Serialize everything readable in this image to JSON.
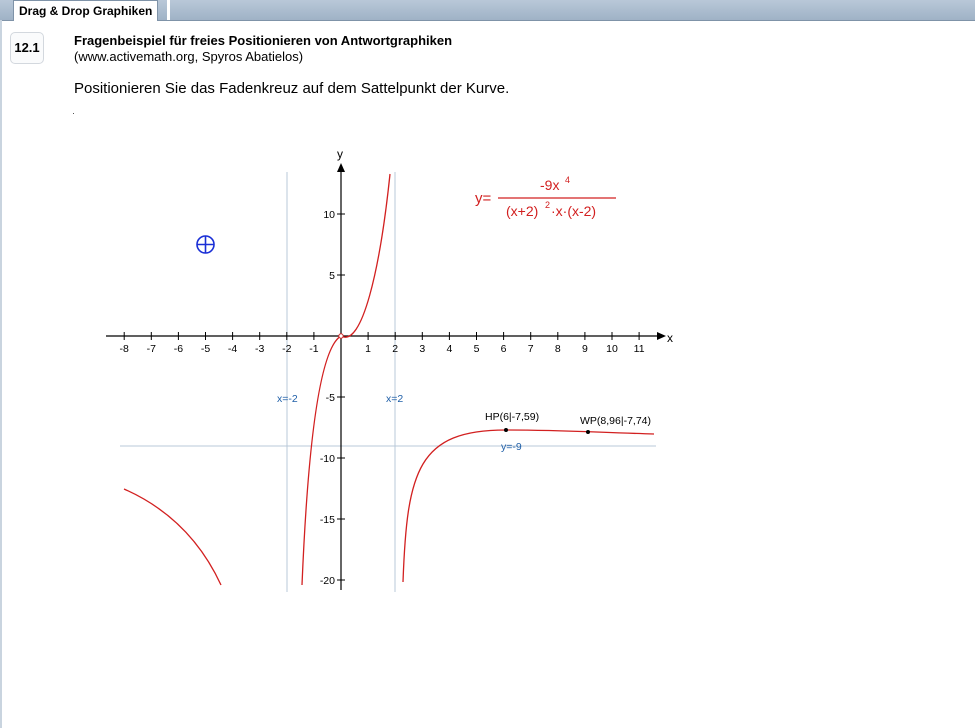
{
  "tab": {
    "label": "Drag & Drop Graphiken"
  },
  "question": {
    "number": "12.1",
    "title": "Fragenbeispiel für freies Positionieren von Antwortgraphiken",
    "subtitle": "(www.activemath.org, Spyros Abatielos)",
    "prompt": "Positionieren Sie das Fadenkreuz auf dem Sattelpunkt der Kurve."
  },
  "graph": {
    "x_axis_label": "x",
    "y_axis_label": "y",
    "x_ticks": [
      "-8",
      "-7",
      "-6",
      "-5",
      "-4",
      "-3",
      "-2",
      "-1",
      "1",
      "2",
      "3",
      "4",
      "5",
      "6",
      "7",
      "8",
      "9",
      "10",
      "11"
    ],
    "y_ticks": [
      "10",
      "5",
      "-5",
      "-10",
      "-15",
      "-20"
    ],
    "asymptote_left": "x=-2",
    "asymptote_right": "x=2",
    "asymptote_horizontal": "y=-9",
    "point_hp": "HP(6|-7,59)",
    "point_wp": "WP(8,96|-7,74)",
    "equation_lhs": "y=",
    "equation_numerator": "-9x",
    "equation_numerator_exp": "4",
    "equation_den_a": "(x+2)",
    "equation_den_exp": "2",
    "equation_den_b": "·x·(x-2)"
  },
  "crosshair": {
    "icon": "crosshair-icon",
    "color": "#1a2fd6",
    "x": -5,
    "y": 7.5
  },
  "colors": {
    "curve": "#d22020",
    "asymptote": "#b8c8d8",
    "asymptote_label": "#1f5fa8"
  }
}
